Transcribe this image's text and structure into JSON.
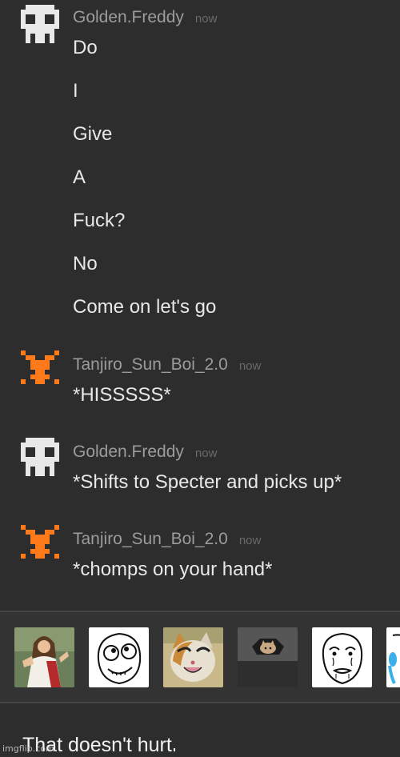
{
  "messages": [
    {
      "user": "Golden.Freddy",
      "time": "now",
      "avatar_icon": "pixel-skull-icon",
      "avatar_color": "#e8e8e8",
      "lines": [
        "Do",
        "I",
        "Give",
        "A",
        "Fuck?",
        "No",
        "Come on let's go"
      ]
    },
    {
      "user": "Tanjiro_Sun_Boi_2.0",
      "time": "now",
      "avatar_icon": "pixel-creature-icon",
      "avatar_color": "#ff7a1a",
      "lines": [
        "*HISSSSS*"
      ]
    },
    {
      "user": "Golden.Freddy",
      "time": "now",
      "avatar_icon": "pixel-skull-icon",
      "avatar_color": "#e8e8e8",
      "lines": [
        "*Shifts to Specter and picks up*"
      ]
    },
    {
      "user": "Tanjiro_Sun_Boi_2.0",
      "time": "now",
      "avatar_icon": "pixel-creature-icon",
      "avatar_color": "#ff7a1a",
      "lines": [
        "*chomps on your hand*"
      ]
    }
  ],
  "reaction_strip": {
    "items": [
      {
        "icon": "buddy-christ-meme-icon"
      },
      {
        "icon": "derp-rage-face-icon"
      },
      {
        "icon": "happy-cat-meme-icon"
      },
      {
        "icon": "ceiling-cat-meme-icon"
      },
      {
        "icon": "okay-rage-face-icon"
      },
      {
        "icon": "crying-face-meme-icon"
      }
    ]
  },
  "input": {
    "caption": "That doesn't hurt"
  },
  "watermark": "imgflip.com"
}
